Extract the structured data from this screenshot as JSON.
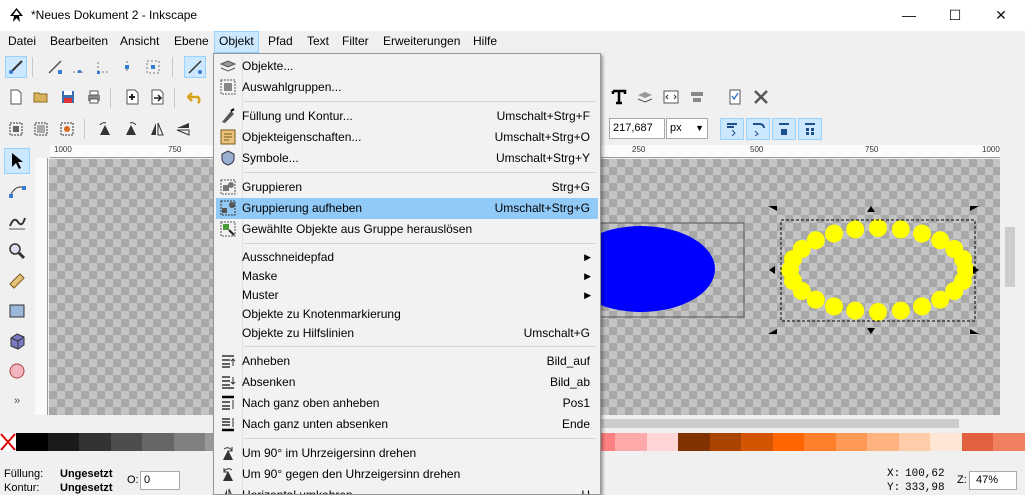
{
  "window": {
    "title": "*Neues Dokument 2 - Inkscape"
  },
  "menubar": [
    {
      "label": "Datei"
    },
    {
      "label": "Bearbeiten"
    },
    {
      "label": "Ansicht"
    },
    {
      "label": "Ebene"
    },
    {
      "label": "Objekt"
    },
    {
      "label": "Pfad"
    },
    {
      "label": "Text"
    },
    {
      "label": "Filter"
    },
    {
      "label": "Erweiterungen"
    },
    {
      "label": "Hilfe"
    }
  ],
  "objekt_menu": [
    {
      "label": "Objekte...",
      "shortcut": "",
      "icon": "objects-icon"
    },
    {
      "label": "Auswahlgruppen...",
      "shortcut": "",
      "icon": "selection-sets-icon"
    },
    {
      "label": "Füllung und Kontur...",
      "shortcut": "Umschalt+Strg+F",
      "icon": "fill-stroke-icon"
    },
    {
      "label": "Objekteigenschaften...",
      "shortcut": "Umschalt+Strg+O",
      "icon": "object-properties-icon"
    },
    {
      "label": "Symbole...",
      "shortcut": "Umschalt+Strg+Y",
      "icon": "symbols-icon"
    },
    {
      "label": "Gruppieren",
      "shortcut": "Strg+G",
      "icon": "group-icon"
    },
    {
      "label": "Gruppierung aufheben",
      "shortcut": "Umschalt+Strg+G",
      "icon": "ungroup-icon"
    },
    {
      "label": "Gewählte Objekte aus Gruppe herauslösen",
      "shortcut": "",
      "icon": "pop-out-group-icon"
    },
    {
      "label": "Ausschneidepfad",
      "shortcut": "",
      "icon": ""
    },
    {
      "label": "Maske",
      "shortcut": "",
      "icon": ""
    },
    {
      "label": "Muster",
      "shortcut": "",
      "icon": ""
    },
    {
      "label": "Objekte zu Knotenmarkierung",
      "shortcut": "",
      "icon": ""
    },
    {
      "label": "Objekte zu Hilfslinien",
      "shortcut": "Umschalt+G",
      "icon": ""
    },
    {
      "label": "Anheben",
      "shortcut": "Bild_auf",
      "icon": "raise-icon"
    },
    {
      "label": "Absenken",
      "shortcut": "Bild_ab",
      "icon": "lower-icon"
    },
    {
      "label": "Nach ganz oben anheben",
      "shortcut": "Pos1",
      "icon": "raise-to-top-icon"
    },
    {
      "label": "Nach ganz unten absenken",
      "shortcut": "Ende",
      "icon": "lower-to-bottom-icon"
    },
    {
      "label": "Um 90° im Uhrzeigersinn drehen",
      "shortcut": "",
      "icon": "rotate-cw-icon"
    },
    {
      "label": "Um 90° gegen den Uhrzeigersinn drehen",
      "shortcut": "",
      "icon": "rotate-ccw-icon"
    },
    {
      "label": "Horizontal umkehren",
      "shortcut": "H",
      "icon": "flip-horizontal-icon"
    }
  ],
  "toolbar": {
    "width_value": "217,687",
    "unit": "px"
  },
  "ruler": {
    "labels": [
      "1000",
      "750",
      "250",
      "500",
      "750",
      "1000"
    ]
  },
  "status": {
    "fill_label": "Füllung:",
    "fill_value": "Ungesetzt",
    "stroke_label": "Kontur:",
    "stroke_value": "Ungesetzt",
    "opacity_label": "O:",
    "opacity_value": "0",
    "x_label": "X:",
    "x_value": "100,62",
    "y_label": "Y:",
    "y_value": "333,98",
    "zoom_label": "Z:",
    "zoom_value": "47%"
  },
  "colors": {
    "ellipse_fill": "#0000ff",
    "dots_fill": "#ffff00",
    "menu_highlight": "#91c9f7"
  },
  "swatches": [
    "#000000",
    "#1a1a1a",
    "#333333",
    "#4d4d4d",
    "#666666",
    "#808080",
    "#999999",
    "#b3b3b3",
    "#cccccc",
    "#e6e6e6",
    "#f2f2f2",
    "#ffffff",
    "#800000",
    "#aa0000",
    "#d40000",
    "#ff0000",
    "#ff2a2a",
    "#ff5555",
    "#ff8080",
    "#ffaaaa",
    "#ffd5d5",
    "#803300",
    "#aa4400",
    "#d45500",
    "#ff6600",
    "#ff7f2a",
    "#ff9955",
    "#ffb380",
    "#ffccaa",
    "#ffe6d5",
    "#e06040",
    "#f08060"
  ]
}
